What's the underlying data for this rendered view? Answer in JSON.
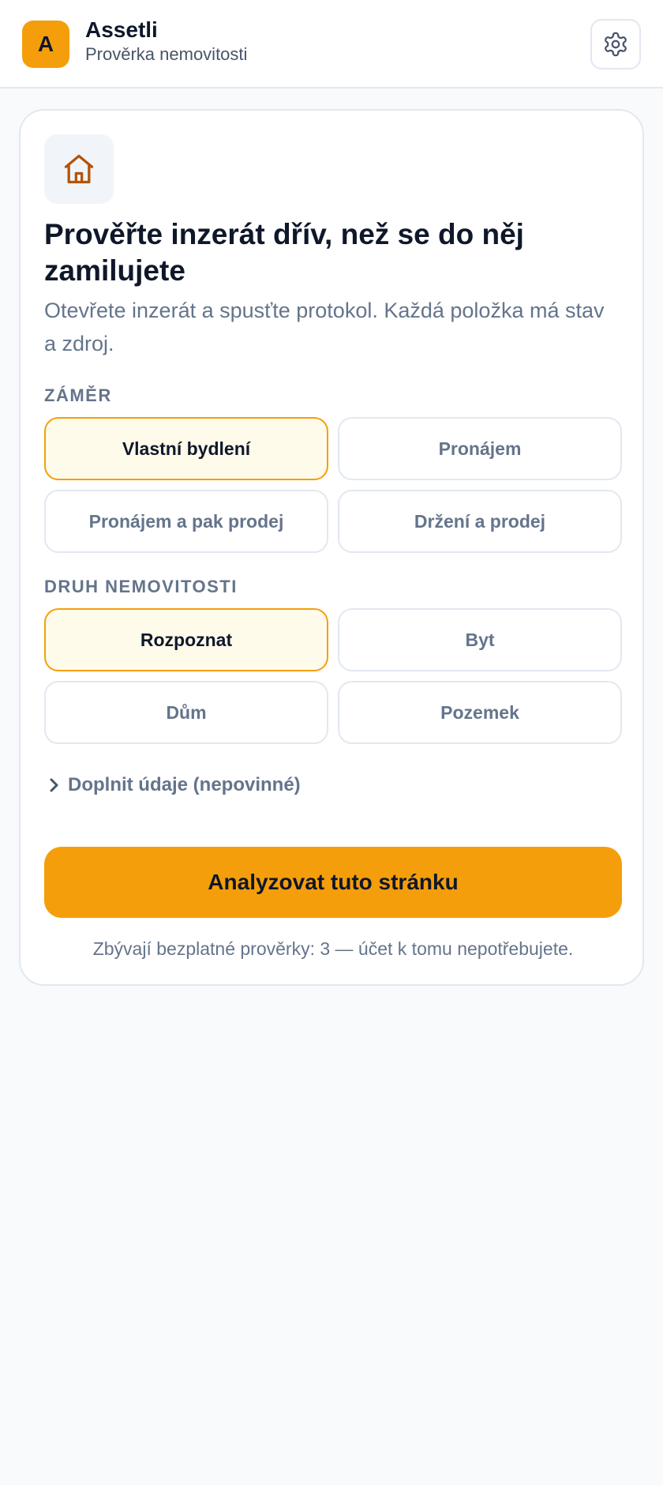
{
  "app": {
    "logo_letter": "A",
    "name": "Assetli",
    "subtitle": "Prověrka nemovitosti"
  },
  "header": {
    "settings_icon": "gear-icon"
  },
  "card": {
    "icon": "home-icon",
    "headline": "Prověřte inzerát dřív, než se do něj zamilujete",
    "description": "Otevřete inzerát a spusťte protokol. Každá položka má stav a zdroj."
  },
  "intent": {
    "label": "ZÁMĚR",
    "options": [
      {
        "label": "Vlastní bydlení",
        "selected": true
      },
      {
        "label": "Pronájem",
        "selected": false
      },
      {
        "label": "Pronájem a pak prodej",
        "selected": false
      },
      {
        "label": "Držení a prodej",
        "selected": false
      }
    ]
  },
  "property_type": {
    "label": "DRUH NEMOVITOSTI",
    "options": [
      {
        "label": "Rozpoznat",
        "selected": true
      },
      {
        "label": "Byt",
        "selected": false
      },
      {
        "label": "Dům",
        "selected": false
      },
      {
        "label": "Pozemek",
        "selected": false
      }
    ]
  },
  "optional_details": {
    "label": "Doplnit údaje (nepovinné)",
    "icon": "chevron-right-icon"
  },
  "cta": {
    "label": "Analyzovat tuto stránku"
  },
  "footnote": "Zbývají bezplatné prověrky: 3 — účet k tomu nepotřebujete.",
  "colors": {
    "accent": "#f59e0b",
    "accent_soft": "#fffbeb",
    "icon_brown": "#b45309",
    "text_muted": "#64748b"
  }
}
